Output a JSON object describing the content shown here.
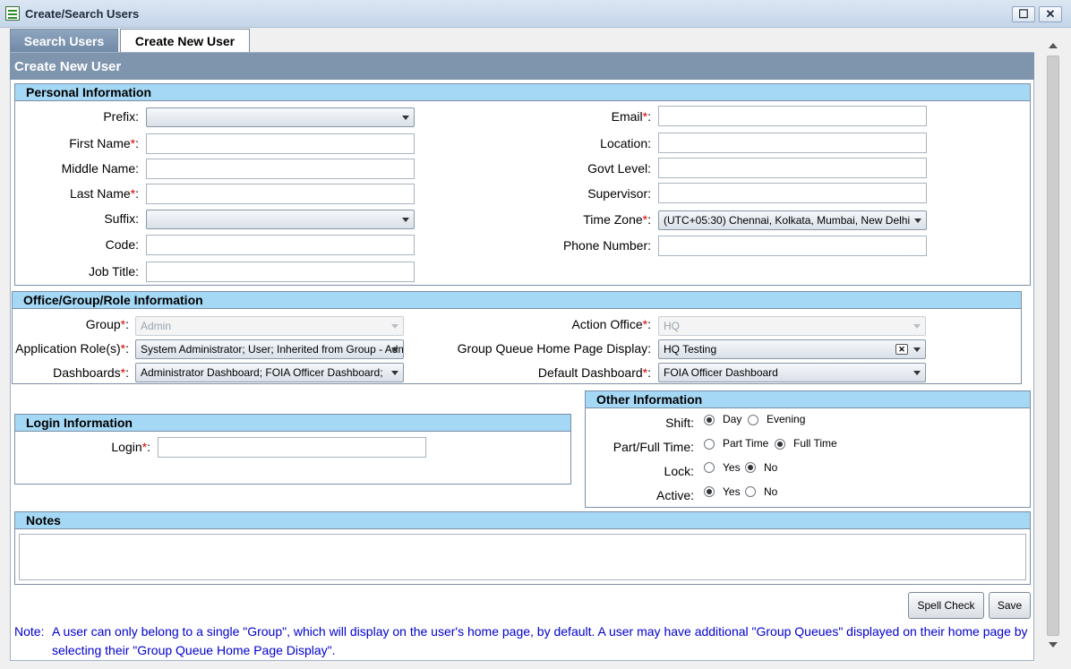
{
  "window": {
    "title": "Create/Search Users",
    "restore_symbol": "☐",
    "close_symbol": "✕"
  },
  "tabs": [
    {
      "label": "Search Users"
    },
    {
      "label": "Create New User"
    }
  ],
  "page_title": "Create New User",
  "personal": {
    "title": "Personal Information",
    "prefix": {
      "label": "Prefix:",
      "value": ""
    },
    "first_name": {
      "label": "First Name",
      "req": "*",
      "colon": ":",
      "value": ""
    },
    "middle_name": {
      "label": "Middle Name:",
      "value": ""
    },
    "last_name": {
      "label": "Last Name",
      "req": "*",
      "colon": ":",
      "value": ""
    },
    "suffix": {
      "label": "Suffix:",
      "value": ""
    },
    "code": {
      "label": "Code:",
      "value": ""
    },
    "job_title": {
      "label": "Job Title:",
      "value": ""
    },
    "email": {
      "label": "Email",
      "req": "*",
      "colon": ":",
      "value": ""
    },
    "location": {
      "label": "Location:",
      "value": ""
    },
    "govt_level": {
      "label": "Govt Level:",
      "value": ""
    },
    "supervisor": {
      "label": "Supervisor:",
      "value": ""
    },
    "time_zone": {
      "label": "Time Zone",
      "req": "*",
      "colon": ":",
      "value": "(UTC+05:30) Chennai, Kolkata, Mumbai, New Delhi"
    },
    "phone": {
      "label": "Phone Number:",
      "value": ""
    }
  },
  "office": {
    "title": "Office/Group/Role Information",
    "group": {
      "label": "Group",
      "req": "*",
      "colon": ":",
      "value": "Admin"
    },
    "app_roles": {
      "label": "Application Role(s)",
      "req": "*",
      "colon": ":",
      "value": "System Administrator; User; Inherited from Group - Administrator"
    },
    "dashboards": {
      "label": "Dashboards",
      "req": "*",
      "colon": ":",
      "value": "Administrator Dashboard; FOIA Officer Dashboard;"
    },
    "action_office": {
      "label": "Action Office",
      "req": "*",
      "colon": ":",
      "value": "HQ"
    },
    "gq_home": {
      "label": "Group Queue Home Page Display:",
      "value": "HQ Testing",
      "clear_symbol": "✕"
    },
    "default_dashboard": {
      "label": "Default Dashboard",
      "req": "*",
      "colon": ":",
      "value": "FOIA Officer Dashboard"
    }
  },
  "login": {
    "title": "Login Information",
    "label": "Login",
    "req": "*",
    "colon": ":",
    "value": ""
  },
  "other": {
    "title": "Other Information",
    "shift": {
      "label": "Shift:",
      "opt1": "Day",
      "opt2": "Evening",
      "selected": "Day"
    },
    "parttime": {
      "label": "Part/Full Time:",
      "opt1": "Part Time",
      "opt2": "Full Time",
      "selected": "Full Time"
    },
    "lock": {
      "label": "Lock:",
      "opt1": "Yes",
      "opt2": "No",
      "selected": "No"
    },
    "active": {
      "label": "Active:",
      "opt1": "Yes",
      "opt2": "No",
      "selected": "Yes"
    }
  },
  "notes": {
    "title": "Notes",
    "value": ""
  },
  "buttons": {
    "spell_check": "Spell Check",
    "save": "Save"
  },
  "note_text": {
    "prefix": "Note:",
    "line1": "A user can only belong to a single \"Group\", which will display on the user's home page, by default. A user may have additional \"Group Queues\" displayed on their home page by",
    "line2": "selecting their \"Group Queue Home Page Display\"."
  }
}
